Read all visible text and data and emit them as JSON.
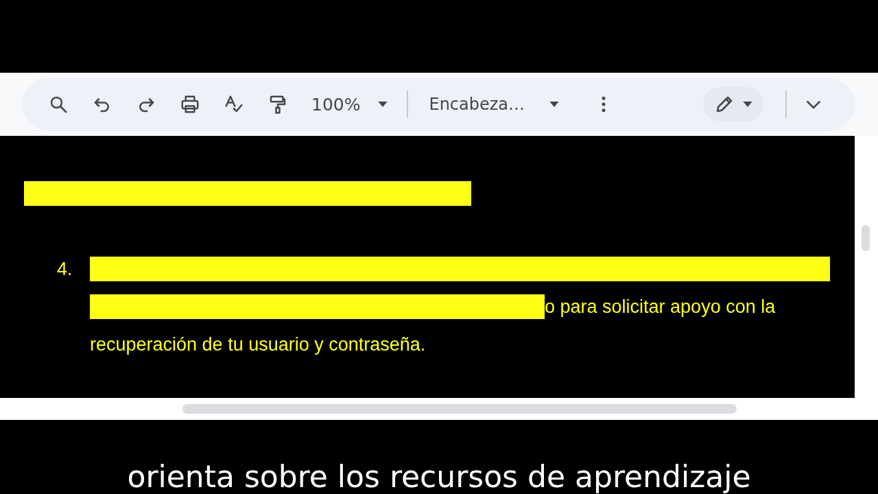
{
  "toolbar": {
    "zoom": "100%",
    "style": "Encabeza…"
  },
  "document": {
    "number": "4.",
    "line_2_text": "o para solicitar apoyo con la",
    "line_3_text": "recuperación de tu usuario y contraseña."
  },
  "subtitle": "orienta sobre los recursos de aprendizaje"
}
